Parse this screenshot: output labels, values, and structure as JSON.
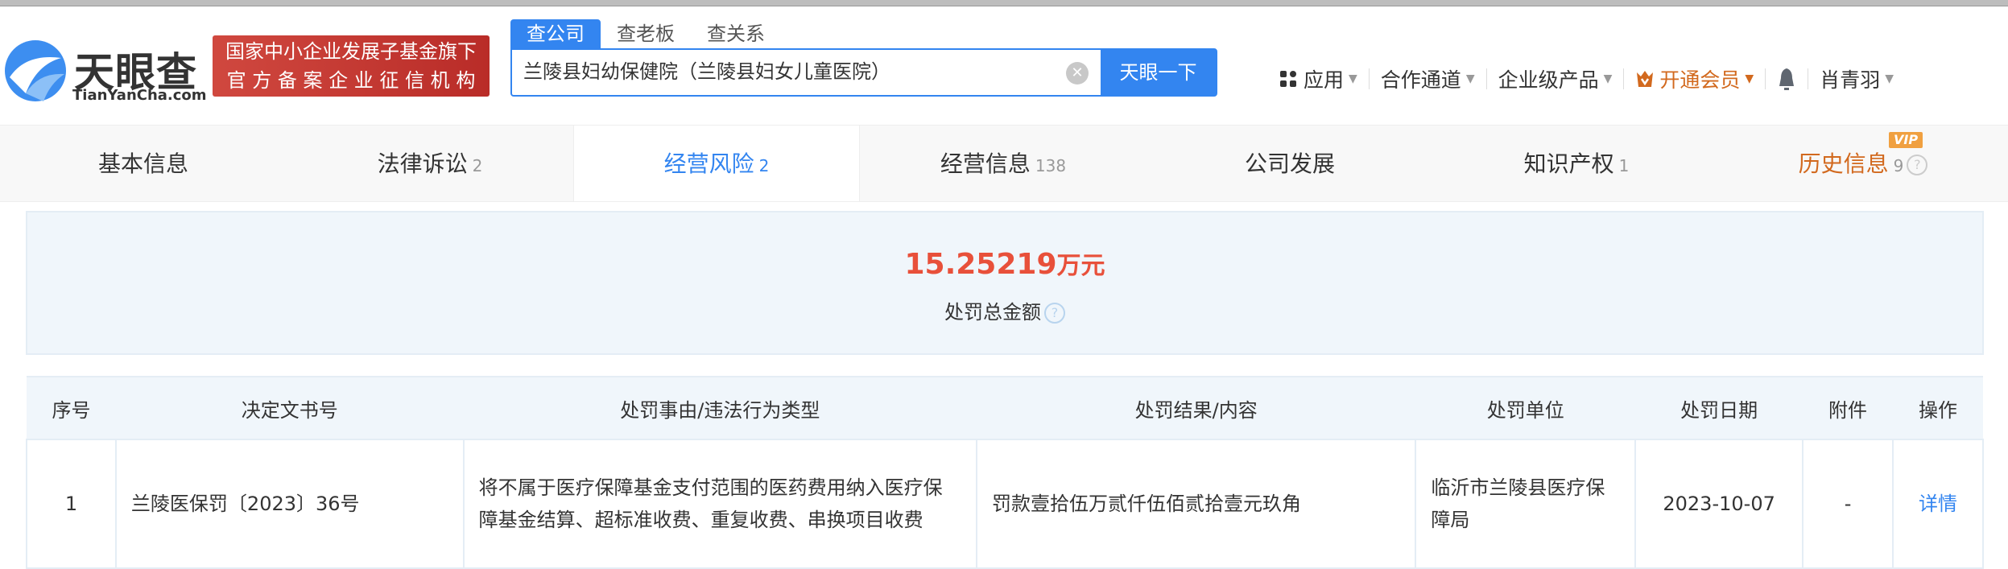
{
  "header": {
    "logo_text": "天眼查",
    "logo_sub": "TianYanCha.com",
    "badge_line1": "国家中小企业发展子基金旗下",
    "badge_line2": "官 方 备 案 企 业 征 信 机 构",
    "search_tabs": [
      "查公司",
      "查老板",
      "查关系"
    ],
    "search_value": "兰陵县妇幼保健院（兰陵县妇女儿童医院）",
    "search_button": "天眼一下",
    "right_nav": {
      "apps": "应用",
      "partner": "合作通道",
      "enterprise": "企业级产品",
      "vip": "开通会员",
      "user": "肖青羽"
    }
  },
  "nav": [
    {
      "label": "基本信息",
      "count": ""
    },
    {
      "label": "法律诉讼",
      "count": "2"
    },
    {
      "label": "经营风险",
      "count": "2"
    },
    {
      "label": "经营信息",
      "count": "138"
    },
    {
      "label": "公司发展",
      "count": ""
    },
    {
      "label": "知识产权",
      "count": "1"
    },
    {
      "label": "历史信息",
      "count": "9",
      "tag": "VIP"
    }
  ],
  "summary": {
    "amount": "15.25219",
    "unit": "万元",
    "label": "处罚总金额"
  },
  "table": {
    "headers": [
      "序号",
      "决定文书号",
      "处罚事由/违法行为类型",
      "处罚结果/内容",
      "处罚单位",
      "处罚日期",
      "附件",
      "操作"
    ],
    "rows": [
      {
        "index": "1",
        "doc_no": "兰陵医保罚〔2023〕36号",
        "reason": "将不属于医疗保障基金支付范围的医药费用纳入医疗保障基金结算、超标准收费、重复收费、串换项目收费",
        "result": "罚款壹拾伍万贰仟伍佰贰拾壹元玖角",
        "unit": "临沂市兰陵县医疗保障局",
        "date": "2023-10-07",
        "attachment": "-",
        "action": "详情"
      }
    ]
  },
  "colors": {
    "accent": "#3385f0",
    "amount": "#e8503a",
    "vip": "#d2691e"
  }
}
